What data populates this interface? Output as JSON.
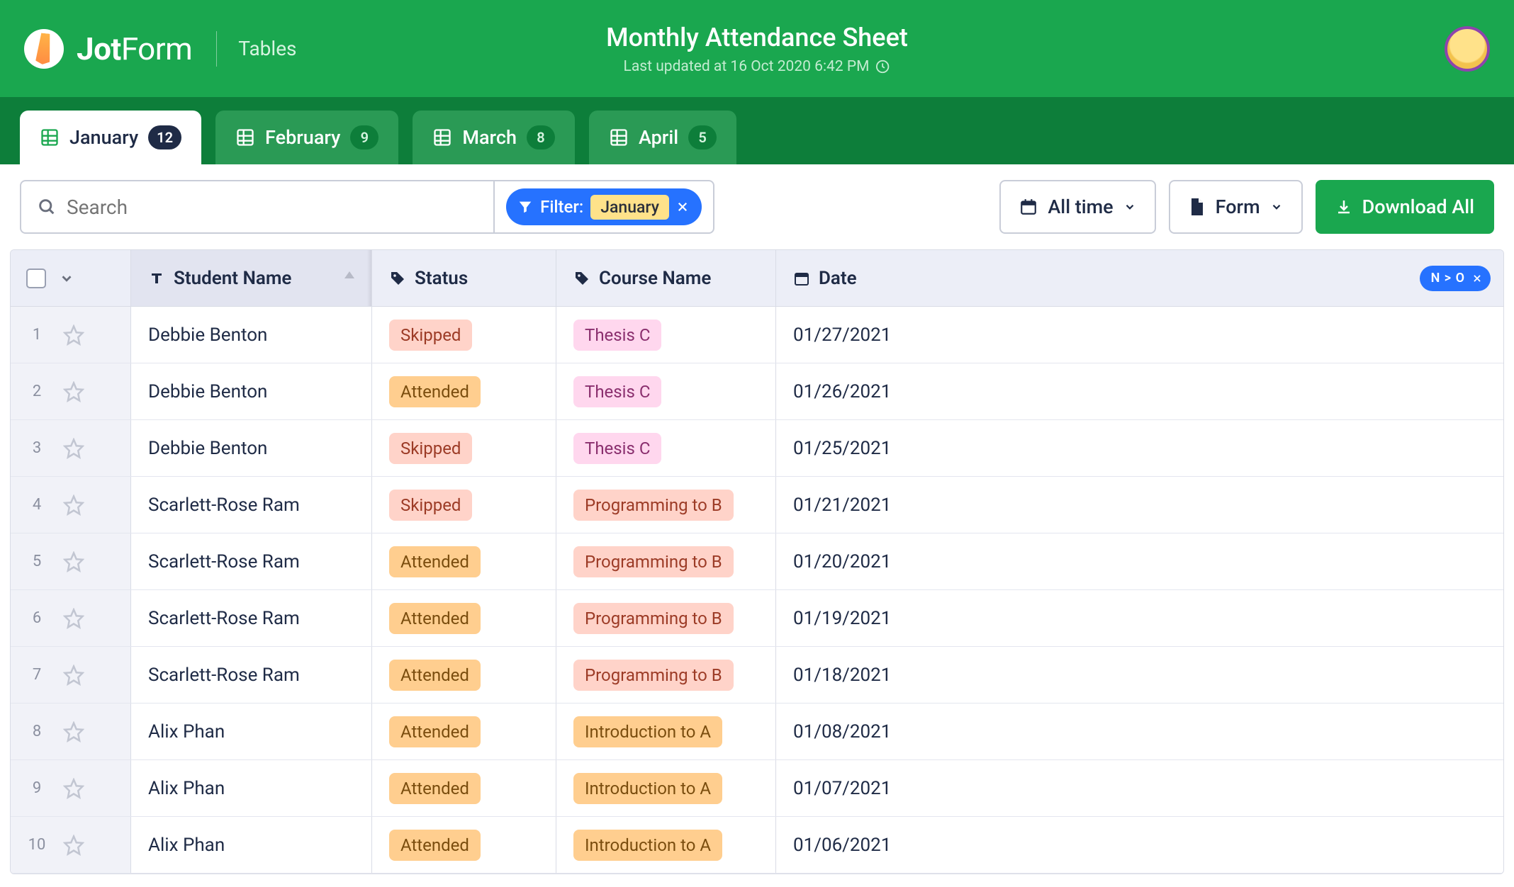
{
  "brand": "JotForm",
  "section": "Tables",
  "title": "Monthly Attendance Sheet",
  "subtitle": "Last updated at 16 Oct 2020 6:42 PM",
  "tabs": [
    {
      "label": "January",
      "count": "12",
      "active": true
    },
    {
      "label": "February",
      "count": "9",
      "active": false
    },
    {
      "label": "March",
      "count": "8",
      "active": false
    },
    {
      "label": "April",
      "count": "5",
      "active": false
    }
  ],
  "toolbar": {
    "search_placeholder": "Search",
    "filter_label": "Filter:",
    "filter_value": "January",
    "time_filter": "All time",
    "form_button": "Form",
    "download_button": "Download All"
  },
  "columns": {
    "name": "Student Name",
    "status": "Status",
    "course": "Course Name",
    "date": "Date",
    "sort_pill": "N > O"
  },
  "rows": [
    {
      "n": "1",
      "name": "Debbie Benton",
      "status": "Skipped",
      "course": "Thesis C",
      "date": "01/27/2021"
    },
    {
      "n": "2",
      "name": "Debbie Benton",
      "status": "Attended",
      "course": "Thesis C",
      "date": "01/26/2021"
    },
    {
      "n": "3",
      "name": "Debbie Benton",
      "status": "Skipped",
      "course": "Thesis C",
      "date": "01/25/2021"
    },
    {
      "n": "4",
      "name": "Scarlett-Rose Ram",
      "status": "Skipped",
      "course": "Programming to B",
      "date": "01/21/2021"
    },
    {
      "n": "5",
      "name": "Scarlett-Rose Ram",
      "status": "Attended",
      "course": "Programming to B",
      "date": "01/20/2021"
    },
    {
      "n": "6",
      "name": "Scarlett-Rose Ram",
      "status": "Attended",
      "course": "Programming to B",
      "date": "01/19/2021"
    },
    {
      "n": "7",
      "name": "Scarlett-Rose Ram",
      "status": "Attended",
      "course": "Programming to B",
      "date": "01/18/2021"
    },
    {
      "n": "8",
      "name": "Alix Phan",
      "status": "Attended",
      "course": "Introduction to A",
      "date": "01/08/2021"
    },
    {
      "n": "9",
      "name": "Alix Phan",
      "status": "Attended",
      "course": "Introduction to A",
      "date": "01/07/2021"
    },
    {
      "n": "10",
      "name": "Alix Phan",
      "status": "Attended",
      "course": "Introduction to A",
      "date": "01/06/2021"
    }
  ]
}
